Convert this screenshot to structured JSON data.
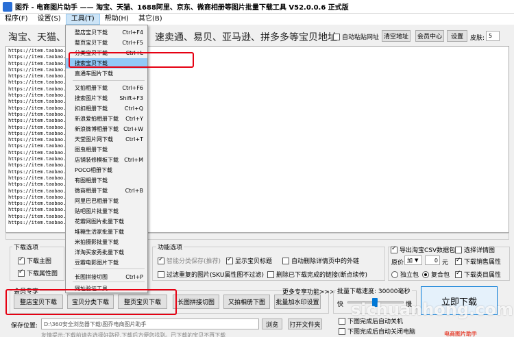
{
  "window": {
    "title": "图乔 - 电商图片助手 —— 淘宝、天猫、1688阿里、京东、微商相册等图片批量下载工具 V52.0.0.6 正式版"
  },
  "menubar": {
    "items": [
      "程序(F)",
      "设置(S)",
      "工具(T)",
      "帮助(H)",
      "其它(B)"
    ]
  },
  "addr": {
    "left_text": "淘宝、天猫、",
    "right_text": "速卖通、易贝、亚马逊、拼多多等宝贝地址:",
    "auto_paste_label": "自动粘贴网址",
    "clear_button": "清空地址",
    "member_button": "会员中心",
    "settings_button": "设置",
    "skin_label": "皮肤:",
    "skin_value": "5"
  },
  "url_lines": [
    "https://item.taobao.",
    "https://item.taobao.",
    "https://item.taobao.",
    "https://item.taobao.",
    "https://item.taobao.",
    "https://item.taobao.",
    "https://item.taobao.",
    "https://item.taobao.",
    "https://item.taobao.",
    "https://item.taobao.",
    "https://item.taobao.",
    "https://item.taobao.",
    "https://item.taobao.",
    "https://item.taobao.",
    "https://item.taobao.",
    "https://item.taobao.",
    "https://item.taobao.",
    "https://item.taobao.",
    "https://item.taobao.",
    "https://item.taobao.",
    "https://item.taobao.",
    "https://item.taobao.",
    "https://item.taobao.",
    "https://item.taobao.",
    "https://item.taobao.",
    "https://item.taobao.",
    "https://item.taobao.",
    "https://item.taobao."
  ],
  "tools_menu": [
    {
      "label": "整店宝贝下载",
      "key": "Ctrl+F4"
    },
    {
      "label": "整页宝贝下载",
      "key": "Ctrl+F5"
    },
    {
      "label": "分类宝贝下载",
      "key": "Ctrl+L"
    },
    {
      "label": "搜索宝贝下载",
      "key": ""
    },
    {
      "label": "直通车图片下载",
      "key": ""
    },
    {
      "label": "又拍相册下载",
      "key": "Ctrl+F6"
    },
    {
      "label": "搜索图片下载",
      "key": "Shift+F3"
    },
    {
      "label": "扣扣相册下载",
      "key": "Ctrl+Q"
    },
    {
      "label": "新浪爱拍相册下载",
      "key": "Ctrl+Y"
    },
    {
      "label": "新浪微博相册下载",
      "key": "Ctrl+W"
    },
    {
      "label": "天堂图片网下载",
      "key": "Ctrl+T"
    },
    {
      "label": "图虫相册下载",
      "key": ""
    },
    {
      "label": "店铺装修模板下载",
      "key": "Ctrl+M"
    },
    {
      "label": "POCO相册下载",
      "key": ""
    },
    {
      "label": "有图相册下载",
      "key": ""
    },
    {
      "label": "微商相册下载",
      "key": "Ctrl+B"
    },
    {
      "label": "阿里巴巴相册下载",
      "key": ""
    },
    {
      "label": "贴吧图片批量下载",
      "key": ""
    },
    {
      "label": "花瓣网图片批量下载",
      "key": ""
    },
    {
      "label": "堆糖生活家批量下载",
      "key": ""
    },
    {
      "label": "米拍摄影批量下载",
      "key": ""
    },
    {
      "label": "洋淘买家秀批量下载",
      "key": ""
    },
    {
      "label": "豆瓣电影图片下载",
      "key": ""
    },
    {
      "label": "长图拼接切图",
      "key": "Ctrl+P"
    },
    {
      "label": "网址验证工具",
      "key": ""
    }
  ],
  "download_options": {
    "title": "下载选项",
    "main_image": "下载主图",
    "attr_image": "下载属性图"
  },
  "function_options": {
    "title": "功能选项",
    "smart_category": "智能分类保存(推荐)",
    "show_title": "显示宝贝标题",
    "auto_delete_outlink": "自动删除详情页中的外链",
    "filter_duplicate": "过滤重复的图片(SKU属性图不过滤)",
    "delete_completed": "删除已下载完成的链接(断点续传)"
  },
  "right_options": {
    "export_csv": "导出淘宝CSV数据包",
    "select_detail": "选择详情图",
    "price_label": "原价",
    "price_op": "加",
    "price_value": "0",
    "price_unit": "元",
    "download_sales": "下载销售属性",
    "single_pkg": "独立包",
    "combined_pkg": "复合包",
    "download_category": "下载类目属性"
  },
  "member": {
    "title": "会员专享",
    "more": "更多专享功能>>>",
    "buttons": [
      "整店宝贝下载",
      "宝贝分类下载",
      "整页宝贝下载",
      "长图拼接切图",
      "又拍相册下图",
      "批量加水印设置"
    ]
  },
  "speed": {
    "label": "批量下载速度: 30000毫秒",
    "fast": "快",
    "slow": "慢"
  },
  "start_button": "立即下载",
  "save": {
    "label": "保存位置:",
    "path": "D:\\360安全浏览器下载\\图乔电商图片助手",
    "browse": "浏览",
    "open_folder": "打开文件夹",
    "tip": "友情提示:下载前请先选择好路径,下载后方便您找到。已下载的宝贝不再下载"
  },
  "after": {
    "opt1": "下图完成后自动关机",
    "opt2": "下图完成后自动关闭电脑"
  },
  "watermark": {
    "main": "sichuanhong.com",
    "sub": "电商图片助手"
  }
}
